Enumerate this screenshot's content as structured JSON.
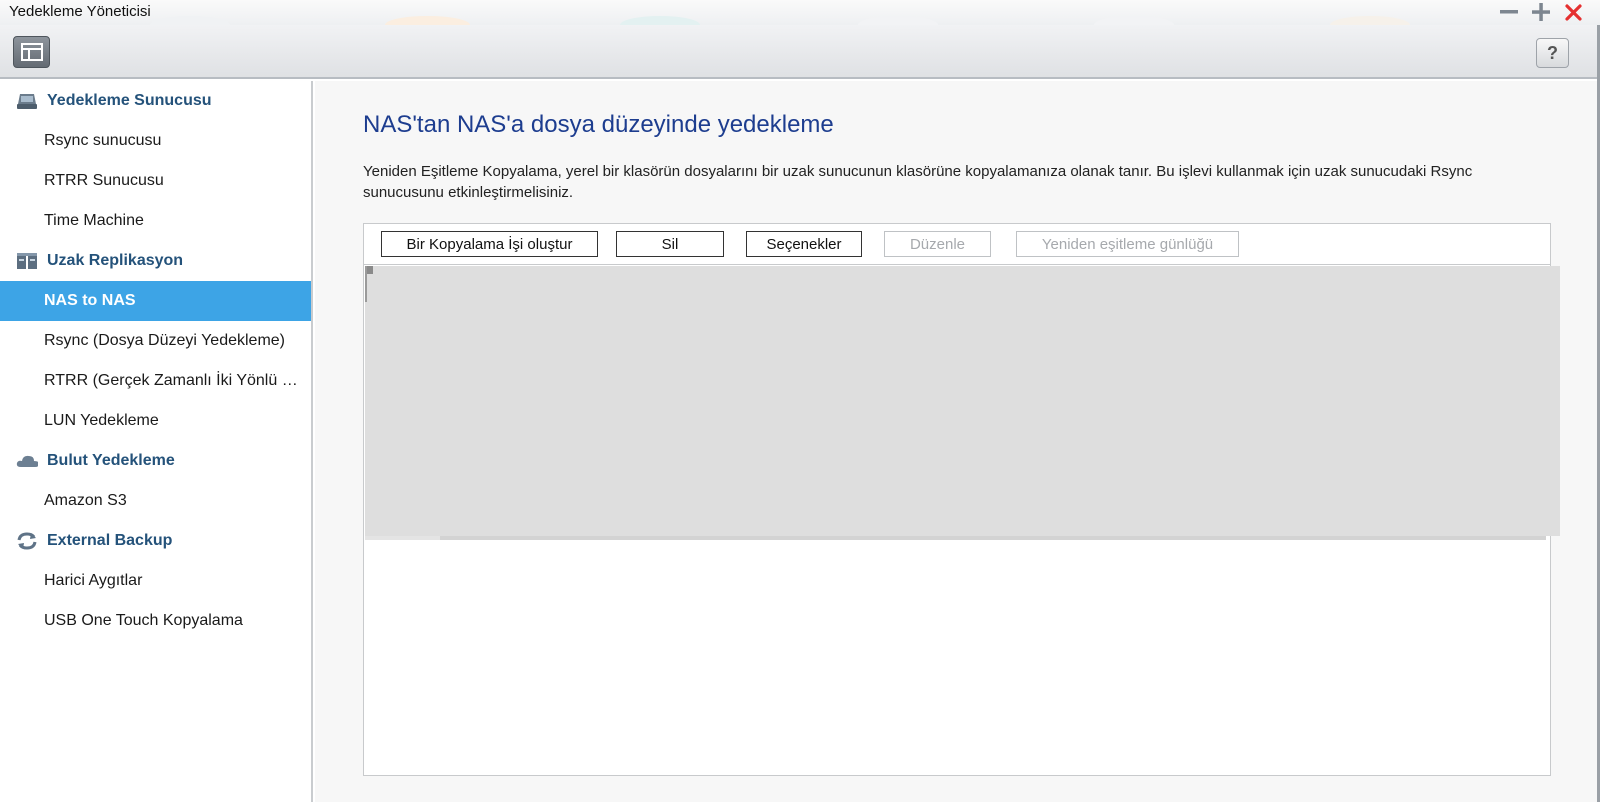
{
  "window": {
    "title": "Yedekleme Yöneticisi",
    "minimize_glyph": "−",
    "maximize_glyph": "+",
    "close_glyph": "✕"
  },
  "toolbar": {
    "panel_toggle_icon": "panel-layout-icon",
    "help_label": "?"
  },
  "sidebar": {
    "groups": [
      {
        "label": "Yedekleme Sunucusu",
        "icon": "server-icon"
      },
      {
        "label": "Uzak Replikasyon",
        "icon": "replication-icon"
      },
      {
        "label": "Bulut Yedekleme",
        "icon": "cloud-icon"
      },
      {
        "label": "External Backup",
        "icon": "sync-icon"
      }
    ],
    "items": [
      {
        "label": "Rsync sunucusu"
      },
      {
        "label": "RTRR Sunucusu"
      },
      {
        "label": "Time Machine"
      },
      {
        "label": "NAS to NAS",
        "active": true
      },
      {
        "label": "Rsync (Dosya Düzeyi Yedekleme)"
      },
      {
        "label": "RTRR (Gerçek Zamanlı İki Yönlü …"
      },
      {
        "label": "LUN Yedekleme"
      },
      {
        "label": "Amazon S3"
      },
      {
        "label": "Harici Aygıtlar"
      },
      {
        "label": "USB One Touch Kopyalama"
      }
    ]
  },
  "main": {
    "title": "NAS'tan NAS'a dosya düzeyinde yedekleme",
    "description": "Yeniden Eşitleme Kopyalama, yerel bir klasörün dosyalarını bir uzak sunucunun klasörüne kopyalamanıza olanak tanır. Bu işlevi kullanmak için uzak sunucudaki Rsync sunucusunu etkinleştirmelisiniz.",
    "buttons": {
      "create": "Bir Kopyalama İşi oluştur",
      "delete": "Sil",
      "options": "Seçenekler",
      "edit": "Düzenle",
      "log": "Yeniden eşitleme günlüğü"
    }
  },
  "colors": {
    "accent": "#3da4e6",
    "group_header": "#24527a",
    "title": "#1d3d8f",
    "close": "#e53030"
  }
}
